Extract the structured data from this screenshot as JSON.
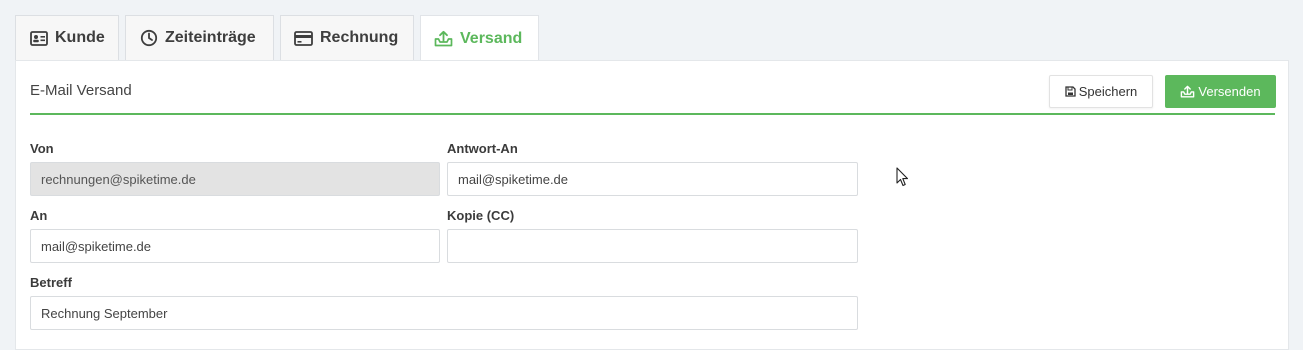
{
  "tabs": [
    {
      "label": "Kunde",
      "icon": "address-card-icon"
    },
    {
      "label": "Zeiteinträge",
      "icon": "clock-icon"
    },
    {
      "label": "Rechnung",
      "icon": "credit-card-icon"
    },
    {
      "label": "Versand",
      "icon": "tray-upload-icon",
      "active": true
    }
  ],
  "panel": {
    "title": "E-Mail Versand",
    "save_label": "Speichern",
    "send_label": "Versenden"
  },
  "form": {
    "von": {
      "label": "Von",
      "value": "rechnungen@spiketime.de"
    },
    "antwort_an": {
      "label": "Antwort-An",
      "value": "mail@spiketime.de"
    },
    "an": {
      "label": "An",
      "value": "mail@spiketime.de"
    },
    "kopie": {
      "label": "Kopie (CC)",
      "value": ""
    },
    "betreff": {
      "label": "Betreff",
      "value": "Rechnung September"
    }
  },
  "colors": {
    "accent": "#5cb85c",
    "background": "#f0f3f6",
    "readonly_field": "#e3e3e3"
  }
}
